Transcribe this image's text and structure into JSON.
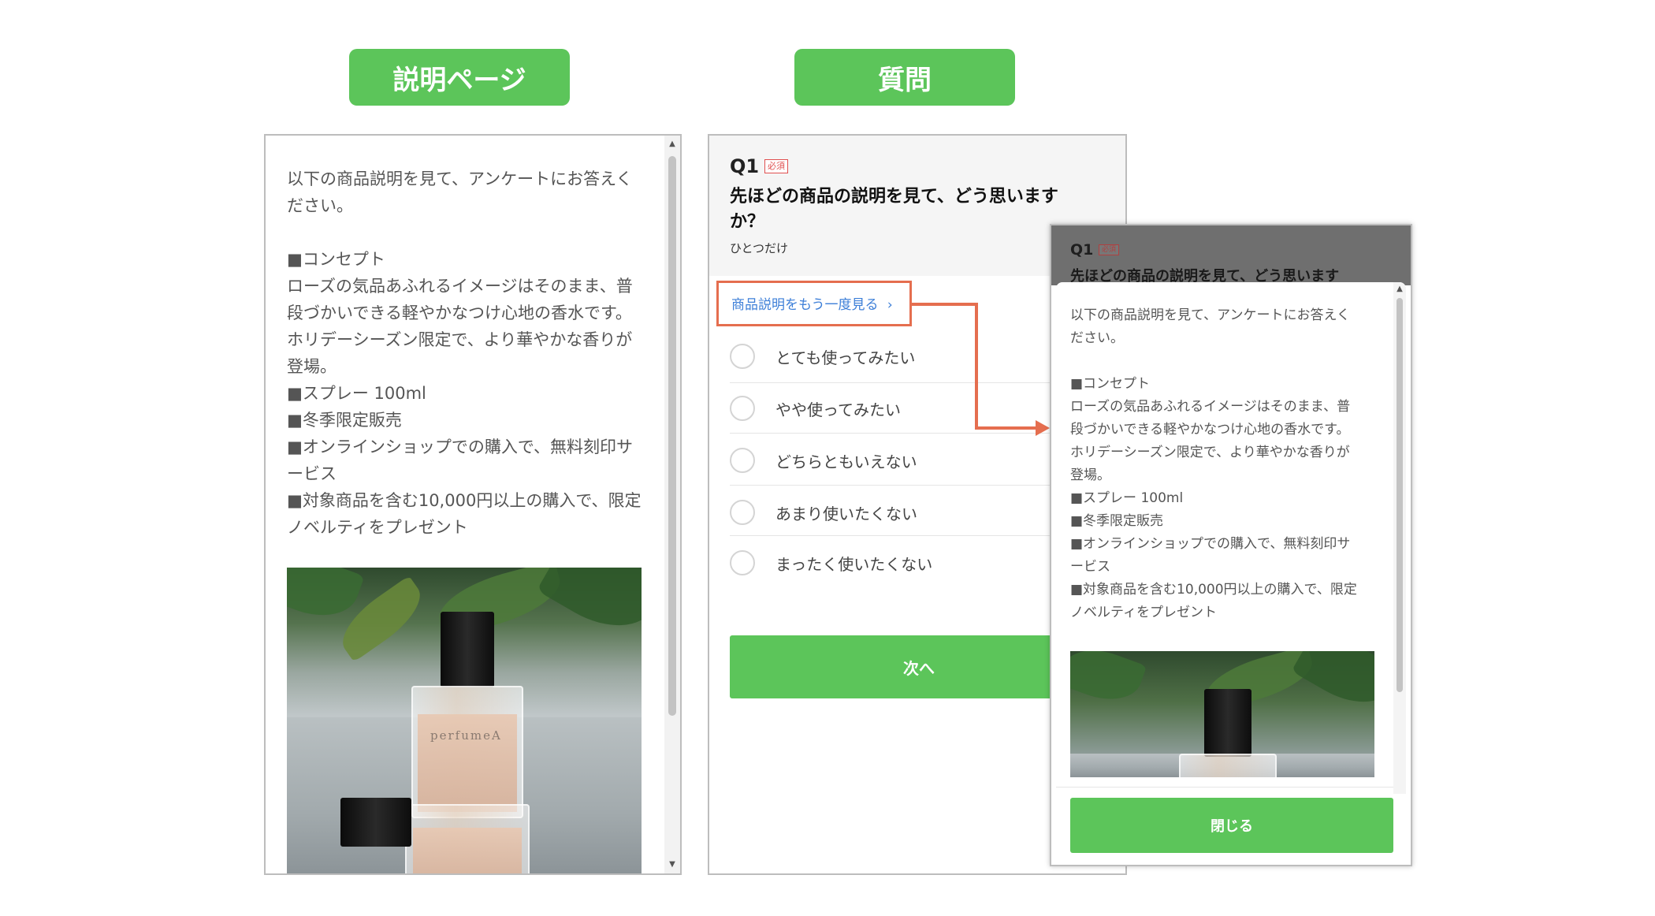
{
  "labels": {
    "left": "説明ページ",
    "right": "質問"
  },
  "description": {
    "text": "以下の商品説明を見て、アンケートにお答えく\nださい。\n\n■コンセプト\nローズの気品あふれるイメージはそのまま、普\n段づかいできる軽やかなつけ心地の香水です。\nホリデーシーズン限定で、より華やかな香りが\n登場。\n■スプレー 100ml\n■冬季限定販売\n■オンラインショップでの購入で、無料刻印サ\nービス\n■対象商品を含む10,000円以上の購入で、限定\nノベルティをプレゼント",
    "photo_brand": "perfumeA"
  },
  "question": {
    "number": "Q1",
    "required_badge": "必須",
    "title": "先ほどの商品の説明を見て、どう思います\nか？",
    "title_short": "先ほどの商品の説明を見て、どう思います",
    "subtitle": "ひとつだけ",
    "review_link": "商品説明をもう一度見る",
    "review_link_chevron": "›",
    "options": [
      "とても使ってみたい",
      "やや使ってみたい",
      "どちらともいえない",
      "あまり使いたくない",
      "まったく使いたくない"
    ],
    "next_button": "次へ"
  },
  "modal": {
    "close_button": "閉じる"
  },
  "colors": {
    "accent_green": "#5cc55a",
    "highlight_orange": "#e56e4f",
    "link_blue": "#3d7fd8",
    "required_red": "#e05050"
  },
  "icons": [
    "radio-icon",
    "chevron-right-icon",
    "scroll-up-arrow-icon",
    "scroll-down-arrow-icon",
    "arrow-right-icon"
  ]
}
